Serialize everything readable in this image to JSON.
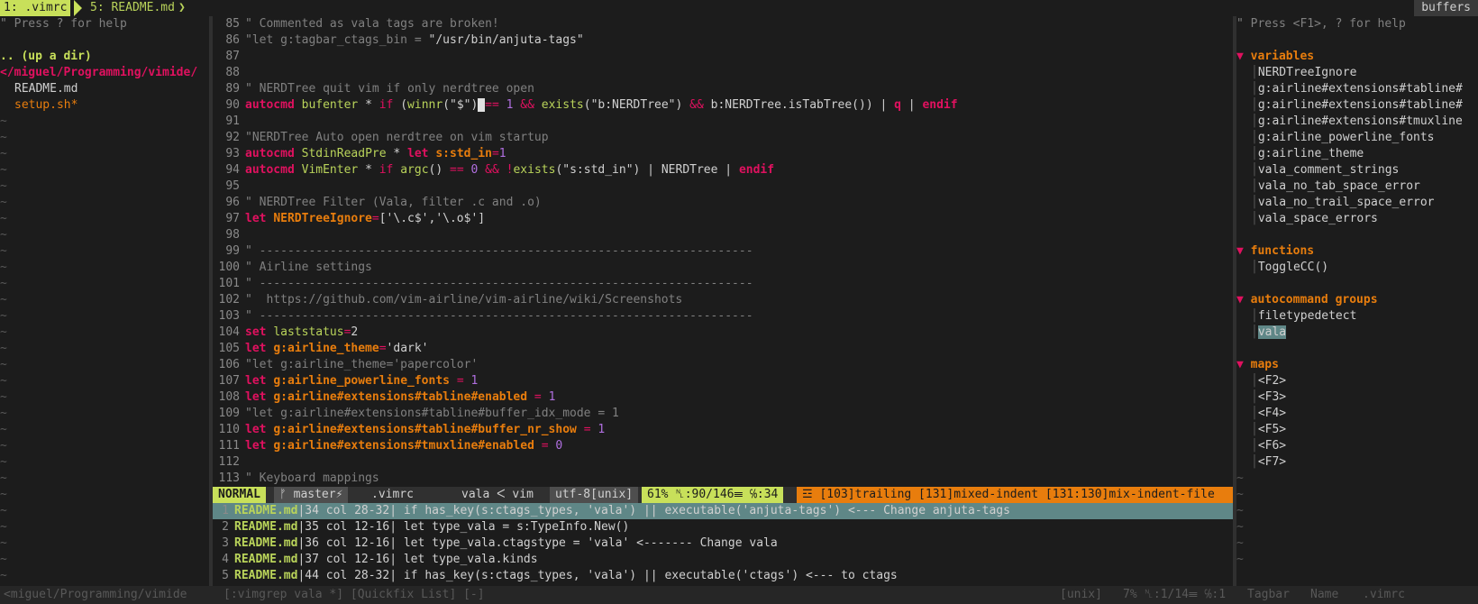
{
  "tabline": {
    "active_tab": "1: .vimrc",
    "other_tab": "5: README.md",
    "right_label": "buffers"
  },
  "nerdtree": {
    "help": "\" Press ? for help",
    "updir": ".. (up a dir)",
    "cwd": "</miguel/Programming/vimide/",
    "files": [
      "README.md",
      "setup.sh*"
    ],
    "tilde": "~"
  },
  "editor": {
    "lines": [
      {
        "n": "85",
        "segs": [
          [
            "c-comment",
            "\" Commented as vala tags are broken!"
          ]
        ]
      },
      {
        "n": "86",
        "segs": [
          [
            "c-comment",
            "\"let g:tagbar_ctags_bin = "
          ],
          [
            "c-str",
            "\"/usr/bin/anjuta-tags\""
          ]
        ]
      },
      {
        "n": "87",
        "segs": []
      },
      {
        "n": "88",
        "segs": []
      },
      {
        "n": "89",
        "segs": [
          [
            "c-comment",
            "\" NERDTree quit vim if only nerdtree open"
          ]
        ]
      },
      {
        "n": "90",
        "segs": [
          [
            "c-kw",
            "autocmd"
          ],
          [
            "c-plain",
            " "
          ],
          [
            "c-fn",
            "bufenter"
          ],
          [
            "c-plain",
            " * "
          ],
          [
            "c-kw2",
            "if"
          ],
          [
            "c-plain",
            " ("
          ],
          [
            "c-fn",
            "winnr"
          ],
          [
            "c-plain",
            "(\"$\")"
          ],
          [
            "c-cursor",
            " "
          ],
          [
            "c-op",
            "=="
          ],
          [
            "c-plain",
            " "
          ],
          [
            "c-num",
            "1"
          ],
          [
            "c-plain",
            " "
          ],
          [
            "c-op",
            "&&"
          ],
          [
            "c-plain",
            " "
          ],
          [
            "c-fn",
            "exists"
          ],
          [
            "c-plain",
            "(\"b:NERDTree\") "
          ],
          [
            "c-op",
            "&&"
          ],
          [
            "c-plain",
            " b:NERDTree.isTabTree()) | "
          ],
          [
            "c-kw",
            "q"
          ],
          [
            "c-plain",
            " | "
          ],
          [
            "c-kw",
            "endif"
          ]
        ]
      },
      {
        "n": "91",
        "segs": []
      },
      {
        "n": "92",
        "segs": [
          [
            "c-comment",
            "\"NERDTree Auto open nerdtree on vim startup"
          ]
        ]
      },
      {
        "n": "93",
        "segs": [
          [
            "c-kw",
            "autocmd"
          ],
          [
            "c-plain",
            " "
          ],
          [
            "c-fn",
            "StdinReadPre"
          ],
          [
            "c-plain",
            " * "
          ],
          [
            "c-kw",
            "let"
          ],
          [
            "c-plain",
            " "
          ],
          [
            "c-var",
            "s:std_in"
          ],
          [
            "c-op",
            "="
          ],
          [
            "c-num",
            "1"
          ]
        ]
      },
      {
        "n": "94",
        "segs": [
          [
            "c-kw",
            "autocmd"
          ],
          [
            "c-plain",
            " "
          ],
          [
            "c-fn",
            "VimEnter"
          ],
          [
            "c-plain",
            " * "
          ],
          [
            "c-kw2",
            "if"
          ],
          [
            "c-plain",
            " "
          ],
          [
            "c-fn",
            "argc"
          ],
          [
            "c-plain",
            "() "
          ],
          [
            "c-op",
            "=="
          ],
          [
            "c-plain",
            " "
          ],
          [
            "c-num",
            "0"
          ],
          [
            "c-plain",
            " "
          ],
          [
            "c-op",
            "&&"
          ],
          [
            "c-plain",
            " "
          ],
          [
            "c-op",
            "!"
          ],
          [
            "c-fn",
            "exists"
          ],
          [
            "c-plain",
            "(\"s:std_in\") | NERDTree | "
          ],
          [
            "c-kw",
            "endif"
          ]
        ]
      },
      {
        "n": "95",
        "segs": []
      },
      {
        "n": "96",
        "segs": [
          [
            "c-comment",
            "\" NERDTree Filter (Vala, filter .c and .o)"
          ]
        ]
      },
      {
        "n": "97",
        "segs": [
          [
            "c-kw",
            "let"
          ],
          [
            "c-plain",
            " "
          ],
          [
            "c-var",
            "NERDTreeIgnore"
          ],
          [
            "c-op",
            "="
          ],
          [
            "c-plain",
            "['\\.c$','\\.o$']"
          ]
        ]
      },
      {
        "n": "98",
        "segs": []
      },
      {
        "n": "99",
        "segs": [
          [
            "c-comment",
            "\" ----------------------------------------------------------------------"
          ]
        ]
      },
      {
        "n": "100",
        "segs": [
          [
            "c-comment",
            "\" Airline settings"
          ]
        ]
      },
      {
        "n": "101",
        "segs": [
          [
            "c-comment",
            "\" ----------------------------------------------------------------------"
          ]
        ]
      },
      {
        "n": "102",
        "segs": [
          [
            "c-comment",
            "\"  https://github.com/vim-airline/vim-airline/wiki/Screenshots"
          ]
        ]
      },
      {
        "n": "103",
        "segs": [
          [
            "c-comment",
            "\" ----------------------------------------------------------------------"
          ]
        ]
      },
      {
        "n": "104",
        "segs": [
          [
            "c-kw",
            "set"
          ],
          [
            "c-plain",
            " "
          ],
          [
            "c-fn",
            "laststatus"
          ],
          [
            "c-op",
            "="
          ],
          [
            "c-plain",
            "2"
          ]
        ]
      },
      {
        "n": "105",
        "segs": [
          [
            "c-kw",
            "let"
          ],
          [
            "c-plain",
            " "
          ],
          [
            "c-var",
            "g:airline_theme"
          ],
          [
            "c-op",
            "="
          ],
          [
            "c-plain",
            "'dark'"
          ]
        ]
      },
      {
        "n": "106",
        "segs": [
          [
            "c-comment",
            "\"let g:airline_theme='papercolor'"
          ]
        ]
      },
      {
        "n": "107",
        "segs": [
          [
            "c-kw",
            "let"
          ],
          [
            "c-plain",
            " "
          ],
          [
            "c-var",
            "g:airline_powerline_fonts"
          ],
          [
            "c-plain",
            " "
          ],
          [
            "c-op",
            "="
          ],
          [
            "c-plain",
            " "
          ],
          [
            "c-num",
            "1"
          ]
        ]
      },
      {
        "n": "108",
        "segs": [
          [
            "c-kw",
            "let"
          ],
          [
            "c-plain",
            " "
          ],
          [
            "c-var",
            "g:airline#extensions#tabline#enabled"
          ],
          [
            "c-plain",
            " "
          ],
          [
            "c-op",
            "="
          ],
          [
            "c-plain",
            " "
          ],
          [
            "c-num",
            "1"
          ]
        ]
      },
      {
        "n": "109",
        "segs": [
          [
            "c-comment",
            "\"let g:airline#extensions#tabline#buffer_idx_mode = 1"
          ]
        ]
      },
      {
        "n": "110",
        "segs": [
          [
            "c-kw",
            "let"
          ],
          [
            "c-plain",
            " "
          ],
          [
            "c-var",
            "g:airline#extensions#tabline#buffer_nr_show"
          ],
          [
            "c-plain",
            " "
          ],
          [
            "c-op",
            "="
          ],
          [
            "c-plain",
            " "
          ],
          [
            "c-num",
            "1"
          ]
        ]
      },
      {
        "n": "111",
        "segs": [
          [
            "c-kw",
            "let"
          ],
          [
            "c-plain",
            " "
          ],
          [
            "c-var",
            "g:airline#extensions#tmuxline#enabled"
          ],
          [
            "c-plain",
            " "
          ],
          [
            "c-op",
            "="
          ],
          [
            "c-plain",
            " "
          ],
          [
            "c-num",
            "0"
          ]
        ]
      },
      {
        "n": "112",
        "segs": []
      },
      {
        "n": "113",
        "segs": [
          [
            "c-comment",
            "\" Keyboard mappings"
          ]
        ]
      }
    ]
  },
  "statusline": {
    "mode": "NORMAL",
    "branch": "ᚠ master⚡",
    "file": ".vimrc",
    "filetype": "vala ᐸ vim",
    "encoding": "utf-8[unix]",
    "position": "61% ␤:90/146☰ ℅:34",
    "warning": "☲ [103]trailing [131]mixed-indent [131:130]mix-indent-file"
  },
  "quickfix": {
    "rows": [
      {
        "n": "1",
        "file": "README.md",
        "pos": "|34 col 28-32|",
        "text": " if has_key(s:ctags_types, 'vala') || executable('anjuta-tags') <--- Change anjuta-tags"
      },
      {
        "n": "2",
        "file": "README.md",
        "pos": "|35 col 12-16|",
        "text": " let type_vala = s:TypeInfo.New()"
      },
      {
        "n": "3",
        "file": "README.md",
        "pos": "|36 col 12-16|",
        "text": " let type_vala.ctagstype = 'vala' <------- Change vala"
      },
      {
        "n": "4",
        "file": "README.md",
        "pos": "|37 col 12-16|",
        "text": " let type_vala.kinds"
      },
      {
        "n": "5",
        "file": "README.md",
        "pos": "|44 col 28-32|",
        "text": " if has_key(s:ctags_types, 'vala') || executable('ctags') <--- to ctags"
      }
    ]
  },
  "tagbar": {
    "help": "\" Press <F1>, ? for help",
    "sections": [
      {
        "title": "variables",
        "items": [
          "NERDTreeIgnore",
          "g:airline#extensions#tabline#",
          "g:airline#extensions#tabline#",
          "g:airline#extensions#tmuxline",
          "g:airline_powerline_fonts",
          "g:airline_theme",
          "vala_comment_strings",
          "vala_no_tab_space_error",
          "vala_no_trail_space_error",
          "vala_space_errors"
        ]
      },
      {
        "title": "functions",
        "items": [
          "ToggleCC()"
        ]
      },
      {
        "title": "autocommand groups",
        "items": [
          "filetypedetect",
          "vala"
        ]
      },
      {
        "title": "maps",
        "items": [
          "<F2>",
          "<F3>",
          "<F4>",
          "<F5>",
          "<F6>",
          "<F7>"
        ]
      }
    ]
  },
  "bottombar": {
    "left": "<miguel/Programming/vimide",
    "quickfix_title": "[:vimgrep vala *] [Quickfix List] [-]",
    "fmt": "[unix]",
    "pos": "7% ␤:1/14☰ ℅:1",
    "tagbar": "Tagbar",
    "name": "Name",
    "file": ".vimrc"
  }
}
